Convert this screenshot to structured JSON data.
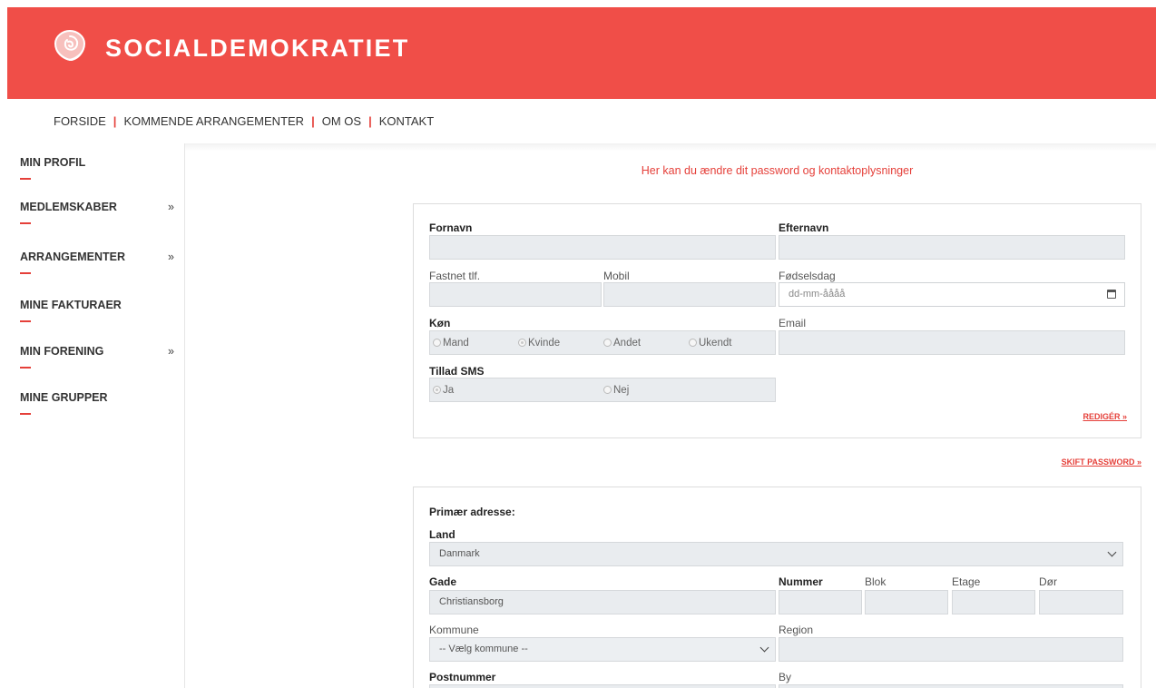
{
  "brand": {
    "name": "SOCIALDEMOKRATIET",
    "logo_icon": "rose-icon",
    "color": "#f04e48"
  },
  "topnav": {
    "items": [
      "FORSIDE",
      "KOMMENDE ARRANGEMENTER",
      "OM OS",
      "KONTAKT"
    ],
    "separator": "|"
  },
  "sidebar": {
    "items": [
      {
        "label": "MIN PROFIL",
        "chevron": ""
      },
      {
        "label": "MEDLEMSKABER",
        "chevron": "»"
      },
      {
        "label": "ARRANGEMENTER",
        "chevron": "»"
      },
      {
        "label": "MINE FAKTURAER",
        "chevron": ""
      },
      {
        "label": "MIN FORENING",
        "chevron": "»"
      },
      {
        "label": "MINE GRUPPER",
        "chevron": ""
      }
    ]
  },
  "intro": "Her kan du ændre dit password og kontaktoplysninger",
  "profile": {
    "fornavn_label": "Fornavn",
    "fornavn_value": "",
    "efternavn_label": "Efternavn",
    "efternavn_value": "",
    "fastnet_label": "Fastnet tlf.",
    "fastnet_value": "",
    "mobil_label": "Mobil",
    "mobil_value": "",
    "fodselsdag_label": "Fødselsdag",
    "fodselsdag_placeholder": "dd-mm-åååå",
    "kon_label": "Køn",
    "kon_options": [
      "Mand",
      "Kvinde",
      "Andet",
      "Ukendt"
    ],
    "kon_selected": "Kvinde",
    "email_label": "Email",
    "email_value": "",
    "sms_label": "Tillad SMS",
    "sms_options": [
      "Ja",
      "Nej"
    ],
    "sms_selected": "Ja",
    "edit_link": "REDIGÉR »"
  },
  "password_link": "SKIFT PASSWORD »",
  "address": {
    "title": "Primær adresse:",
    "land_label": "Land",
    "land_value": "Danmark",
    "gade_label": "Gade",
    "gade_value": "Christiansborg",
    "nummer_label": "Nummer",
    "blok_label": "Blok",
    "etage_label": "Etage",
    "dor_label": "Dør",
    "kommune_label": "Kommune",
    "kommune_value": "-- Vælg kommune --",
    "region_label": "Region",
    "postnummer_label": "Postnummer",
    "by_label": "By"
  }
}
